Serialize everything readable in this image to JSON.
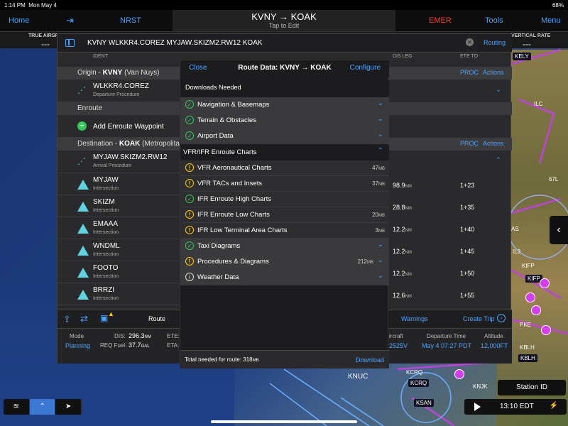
{
  "status": {
    "time": "1:14 PM",
    "date": "Mon May 4",
    "battery": "68%"
  },
  "nav": {
    "home": "Home",
    "transfer_icon": "transfer-icon",
    "nrst": "NRST",
    "title": "KVNY → KOAK",
    "subtitle": "Tap to Edit",
    "emer": "EMER",
    "tools": "Tools",
    "menu": "Menu"
  },
  "databar": {
    "true_airspeed": "TRUE AIRSP",
    "tas_val": "---",
    "vertical_rate": "VERTICAL RATE",
    "vr_val": "---"
  },
  "route": {
    "string": "KVNY WLKKR4.COREZ MYJAW.SKIZM2.RW12 KOAK",
    "clear": "✕",
    "routing": "Routing"
  },
  "cols": {
    "ident": "IDENT",
    "dis_leg": "DIS LEG",
    "ete_to": "ETE TO"
  },
  "sections": {
    "origin_prefix": "Origin - ",
    "origin_code": "KVNY",
    "origin_name": " (Van Nuys)",
    "enroute": "Enroute",
    "dest_prefix": "Destination - ",
    "dest_code": "KOAK",
    "dest_name": " (Metropolitan O",
    "proc": "PROC",
    "actions": "Actions"
  },
  "origin_proc": {
    "name": "WLKKR4.COREZ",
    "sub": "Departure Procedure"
  },
  "add_waypoint": "Add Enroute Waypoint",
  "arrival_proc": {
    "name": "MYJAW.SKIZM2.RW12",
    "sub": "Arrival Procedure"
  },
  "waypoints": [
    {
      "name": "MYJAW",
      "sub": "Intersection",
      "dis": "98.9",
      "unit": "NM",
      "ete": "1+23"
    },
    {
      "name": "SKIZM",
      "sub": "Intersection",
      "dis": "28.8",
      "unit": "NM",
      "ete": "1+35"
    },
    {
      "name": "EMAAA",
      "sub": "Intersection",
      "dis": "12.2",
      "unit": "NM",
      "ete": "1+40"
    },
    {
      "name": "WNDML",
      "sub": "Intersection",
      "dis": "12.2",
      "unit": "NM",
      "ete": "1+45"
    },
    {
      "name": "FOOTO",
      "sub": "Intersection",
      "dis": "12.2",
      "unit": "NM",
      "ete": "1+50"
    },
    {
      "name": "BRRZI",
      "sub": "Intersection",
      "dis": "12.6",
      "unit": "NM",
      "ete": "1+55"
    }
  ],
  "toolbar": {
    "route": "Route",
    "warnings": "Warnings",
    "create_trip": "Create Trip"
  },
  "summary": {
    "mode_k": "Mode",
    "mode_v": "Planning",
    "dis_k": "DIS:",
    "dis_v": "296.3",
    "dis_u": "NM",
    "fuel_k": "REQ Fuel:",
    "fuel_v": "37.7",
    "fuel_u": "GAL",
    "ete_k": "ETE:",
    "eta_k": "ETA:",
    "aircraft_k": "ircraft",
    "aircraft_v": "2525V",
    "dep_k": "Departure Time",
    "dep_v": "May 4  07:27 PDT",
    "alt_k": "Altitude",
    "alt_v": "12,000FT"
  },
  "modal": {
    "close": "Close",
    "title": "Route Data: KVNY → KOAK",
    "configure": "Configure",
    "downloads_needed": "Downloads Needed",
    "nav_basemaps": "Navigation & Basemaps",
    "terrain": "Terrain & Obstacles",
    "airport": "Airport Data",
    "vfr_ifr": "VFR/IFR Enroute Charts",
    "vfr_aero": "VFR Aeronautical Charts",
    "vfr_aero_sz": "47",
    "mb": "MB",
    "vfr_tacs": "VFR TACs and Insets",
    "vfr_tacs_sz": "37",
    "ifr_high": "IFR Enroute High Charts",
    "ifr_low": "IFR Enroute Low Charts",
    "ifr_low_sz": "20",
    "ifr_term": "IFR Low Terminal Area Charts",
    "ifr_term_sz": "3",
    "taxi": "Taxi Diagrams",
    "procs": "Procedures & Diagrams",
    "procs_sz": "212",
    "weather": "Weather Data",
    "total_label": "Total needed for route: ",
    "total_val": "318",
    "download": "Download"
  },
  "map": {
    "station": "Station ID",
    "time": "13:10 EDT",
    "labels": [
      "KELY",
      "ILC",
      "67L",
      "AS",
      "IL3",
      "KIFP",
      "KIFP",
      "PKE",
      "KBLH",
      "KBLH",
      "KCRQ",
      "KCRQ",
      "KNJK",
      "KSAN",
      "KNUC"
    ]
  }
}
